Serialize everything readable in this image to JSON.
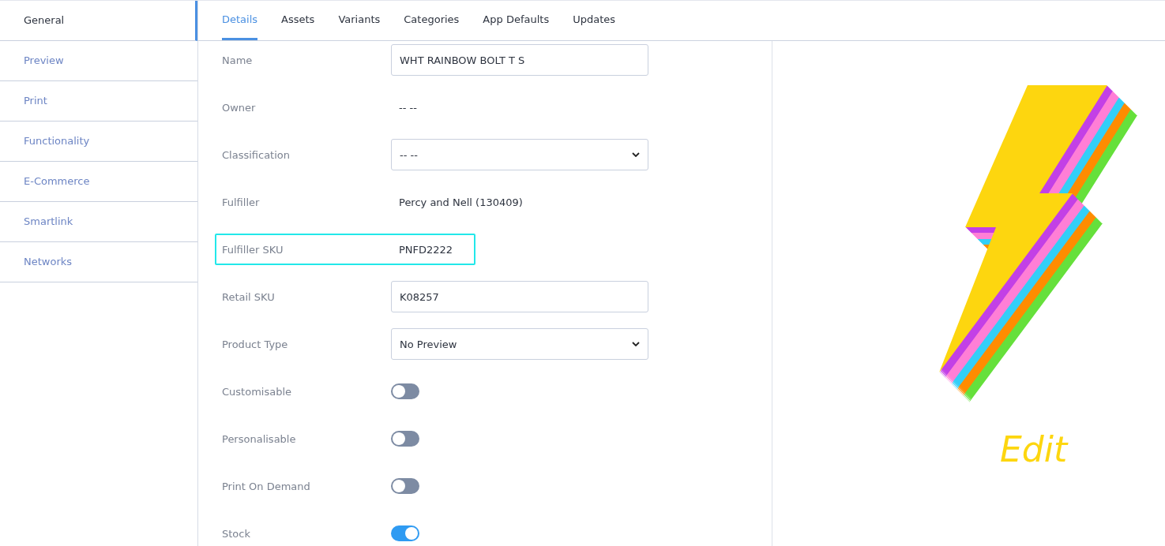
{
  "sidebar": {
    "items": [
      {
        "label": "General",
        "selected": true
      },
      {
        "label": "Preview",
        "selected": false
      },
      {
        "label": "Print",
        "selected": false
      },
      {
        "label": "Functionality",
        "selected": false
      },
      {
        "label": "E-Commerce",
        "selected": false
      },
      {
        "label": "Smartlink",
        "selected": false
      },
      {
        "label": "Networks",
        "selected": false
      }
    ]
  },
  "tabs": [
    {
      "label": "Details",
      "selected": true
    },
    {
      "label": "Assets",
      "selected": false
    },
    {
      "label": "Variants",
      "selected": false
    },
    {
      "label": "Categories",
      "selected": false
    },
    {
      "label": "App Defaults",
      "selected": false
    },
    {
      "label": "Updates",
      "selected": false
    }
  ],
  "form": {
    "fields": [
      {
        "kind": "input",
        "label": "Name",
        "value": "WHT RAINBOW BOLT T S",
        "highlighted": false
      },
      {
        "kind": "text",
        "label": "Owner",
        "value": "-- --",
        "highlighted": false
      },
      {
        "kind": "select",
        "label": "Classification",
        "value": "-- --",
        "highlighted": false
      },
      {
        "kind": "text",
        "label": "Fulfiller",
        "value": "Percy and Nell (130409)",
        "highlighted": false
      },
      {
        "kind": "text",
        "label": "Fulfiller SKU",
        "value": "PNFD2222",
        "highlighted": true
      },
      {
        "kind": "input",
        "label": "Retail SKU",
        "value": "K08257",
        "highlighted": false
      },
      {
        "kind": "select",
        "label": "Product Type",
        "value": "No Preview",
        "highlighted": false
      },
      {
        "kind": "toggle",
        "label": "Customisable",
        "on": false,
        "highlighted": false
      },
      {
        "kind": "toggle",
        "label": "Personalisable",
        "on": false,
        "highlighted": false
      },
      {
        "kind": "toggle",
        "label": "Print On Demand",
        "on": false,
        "highlighted": false
      },
      {
        "kind": "toggle",
        "label": "Stock",
        "on": true,
        "highlighted": false
      }
    ]
  },
  "preview": {
    "caption": "Edit"
  }
}
